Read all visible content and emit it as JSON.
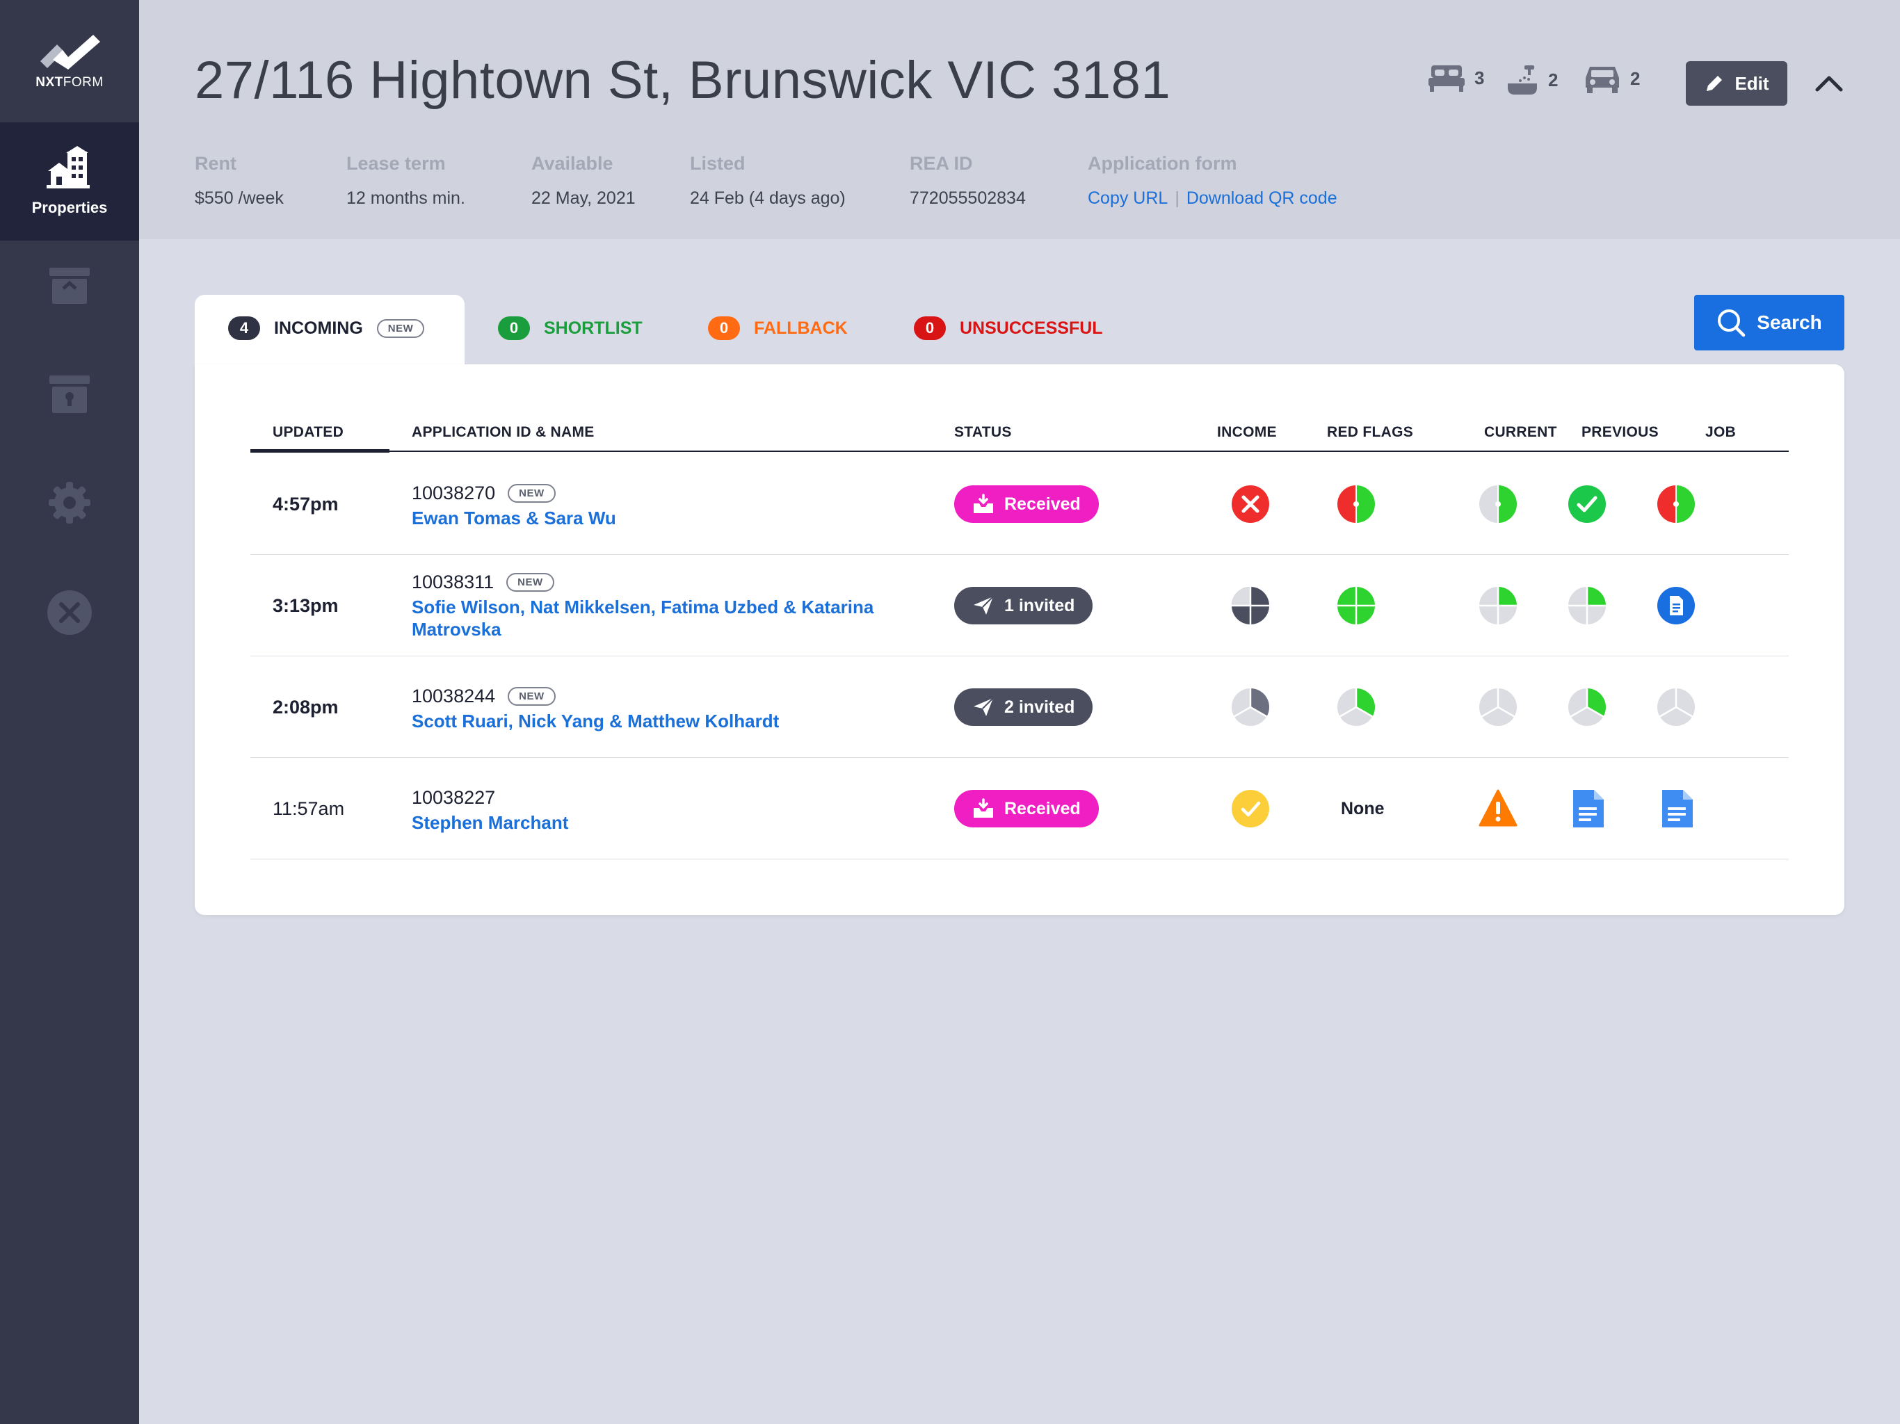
{
  "sidebar": {
    "logo_text_bold": "NXT",
    "logo_text_light": "FORM",
    "active_label": "Properties"
  },
  "header": {
    "title": "27/116 Hightown St, Brunswick VIC 3181",
    "bedrooms": "3",
    "bathrooms": "2",
    "car_spaces": "2",
    "edit_label": "Edit",
    "meta": {
      "rent_label": "Rent",
      "rent_value": "$550 /week",
      "lease_label": "Lease term",
      "lease_value": "12 months min.",
      "available_label": "Available",
      "available_value": "22 May, 2021",
      "listed_label": "Listed",
      "listed_value": "24 Feb (4 days ago)",
      "rea_label": "REA ID",
      "rea_value": "772055502834",
      "appform_label": "Application form",
      "copy_url": "Copy URL",
      "link_separator": "|",
      "download_qr": "Download QR code"
    }
  },
  "tabs": {
    "incoming": {
      "count": "4",
      "label": "INCOMING",
      "badge": "NEW"
    },
    "shortlist": {
      "count": "0",
      "label": "SHORTLIST"
    },
    "fallback": {
      "count": "0",
      "label": "FALLBACK"
    },
    "unsuccessful": {
      "count": "0",
      "label": "UNSUCCESSFUL"
    }
  },
  "search_label": "Search",
  "colors": {
    "accent": "#1a6fe0",
    "shortlist": "#1a9d3c",
    "fallback": "#ff6a13",
    "unsuccessful": "#d81414",
    "received": "#f01fc4",
    "invited": "#4a4e5e"
  },
  "table": {
    "columns": {
      "updated": "UPDATED",
      "application": "APPLICATION ID & NAME",
      "status": "STATUS",
      "income": "INCOME",
      "red_flags": "RED FLAGS",
      "current": "CURRENT",
      "previous": "PREVIOUS",
      "job": "JOB"
    },
    "rows": [
      {
        "time": "4:57pm",
        "id": "10038270",
        "badge": "NEW",
        "names": "Ewan Tomas & Sara Wu",
        "status": "Received",
        "income": "x-circle-icon",
        "red_flags": "half-red-green-icon",
        "current": "half-green-icon",
        "previous": "check-circle-icon",
        "job": "half-red-green-icon"
      },
      {
        "time": "3:13pm",
        "id": "10038311",
        "badge": "NEW",
        "names": "Sofie Wilson, Nat Mikkelsen, Fatima Uzbed & Katarina Matrovska",
        "status": "1 invited",
        "income": "pie-quarter-gray-icon",
        "red_flags": "pie-full-green-icon",
        "current": "pie-quarter-green-icon",
        "previous": "pie-quarter-green-icon",
        "job": "document-circle-icon"
      },
      {
        "time": "2:08pm",
        "id": "10038244",
        "badge": "NEW",
        "names": "Scott Ruari, Nick Yang & Matthew Kolhardt",
        "status": "2 invited",
        "income": "pie-third-gray-icon",
        "red_flags": "pie-third-green-icon",
        "current": "pie-empty-icon",
        "previous": "pie-third-green-icon",
        "job": "pie-empty-icon"
      },
      {
        "time": "11:57am",
        "id": "10038227",
        "badge": "",
        "names": "Stephen Marchant",
        "status": "Received",
        "income": "check-yellow-icon",
        "red_flags_text": "None",
        "current": "warning-icon",
        "previous": "document-icon",
        "job": "document-icon"
      }
    ]
  }
}
